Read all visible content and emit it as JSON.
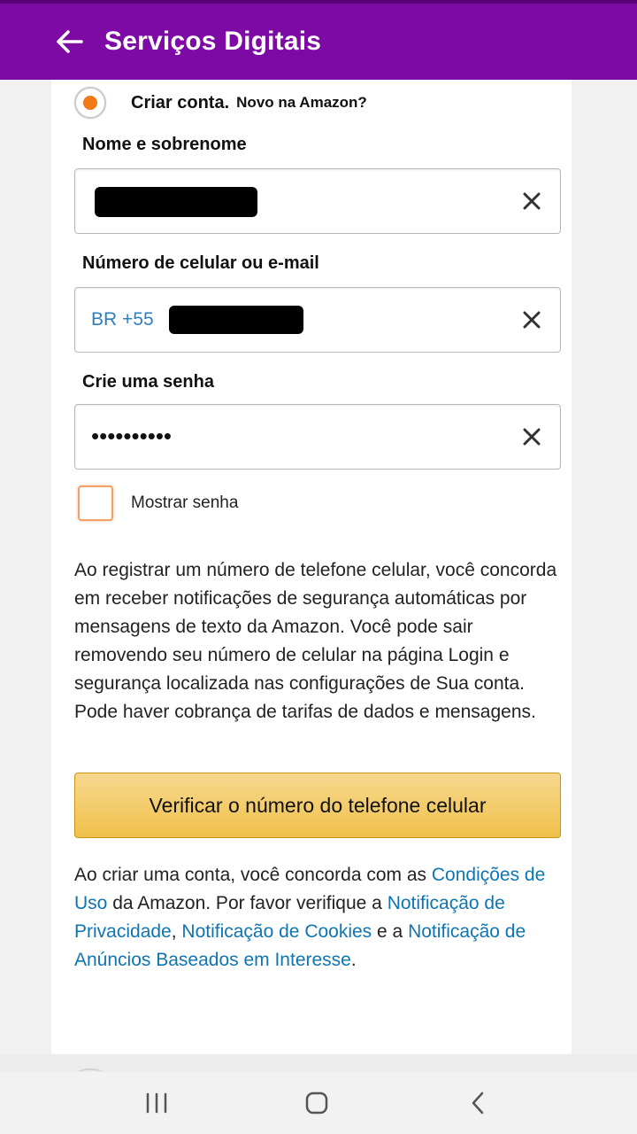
{
  "appbar": {
    "title": "Serviços Digitais",
    "color": "#7d0aa5",
    "back_icon": "arrow-left-icon"
  },
  "create_account": {
    "option_label": "Criar conta.",
    "option_sub": "Novo na Amazon?",
    "selected": true
  },
  "name_field": {
    "label": "Nome e sobrenome",
    "value_redacted": true,
    "clear_icon": "close-icon"
  },
  "phone_field": {
    "label": "Número de celular ou e-mail",
    "country_prefix": "BR +55",
    "value_redacted": true,
    "clear_icon": "close-icon"
  },
  "password_field": {
    "label": "Crie uma senha",
    "masked_value": "••••••••••",
    "clear_icon": "close-icon"
  },
  "show_password": {
    "label": "Mostrar senha",
    "checked": false
  },
  "notice": {
    "text": "Ao registrar um número de telefone celular, você concorda em receber notificações de segurança automáticas por mensagens de texto da Amazon. Você pode sair removendo seu número de celular na página Login e segurança localizada nas configurações de Sua conta. Pode haver cobrança de tarifas de dados e mensagens."
  },
  "verify_button": {
    "label": "Verificar o número do telefone celular",
    "color": "#f0c14b"
  },
  "terms": {
    "intro": "Ao criar uma conta, você concorda com as ",
    "conditions_link": "Condições de Uso",
    "after_conditions": " da Amazon. Por favor verifique a ",
    "privacy_link": "Notificação de Privacidade",
    "comma": ", ",
    "cookies_link": "Notificação de Cookies",
    "and": " e a ",
    "ads_link": "Notificação de Anúncios Baseados em Interesse",
    "end": ".",
    "link_color": "#0f75b0"
  },
  "system_nav": {
    "recents_icon": "recent-apps-icon",
    "home_icon": "home-icon",
    "back_icon": "back-chevron-icon"
  }
}
